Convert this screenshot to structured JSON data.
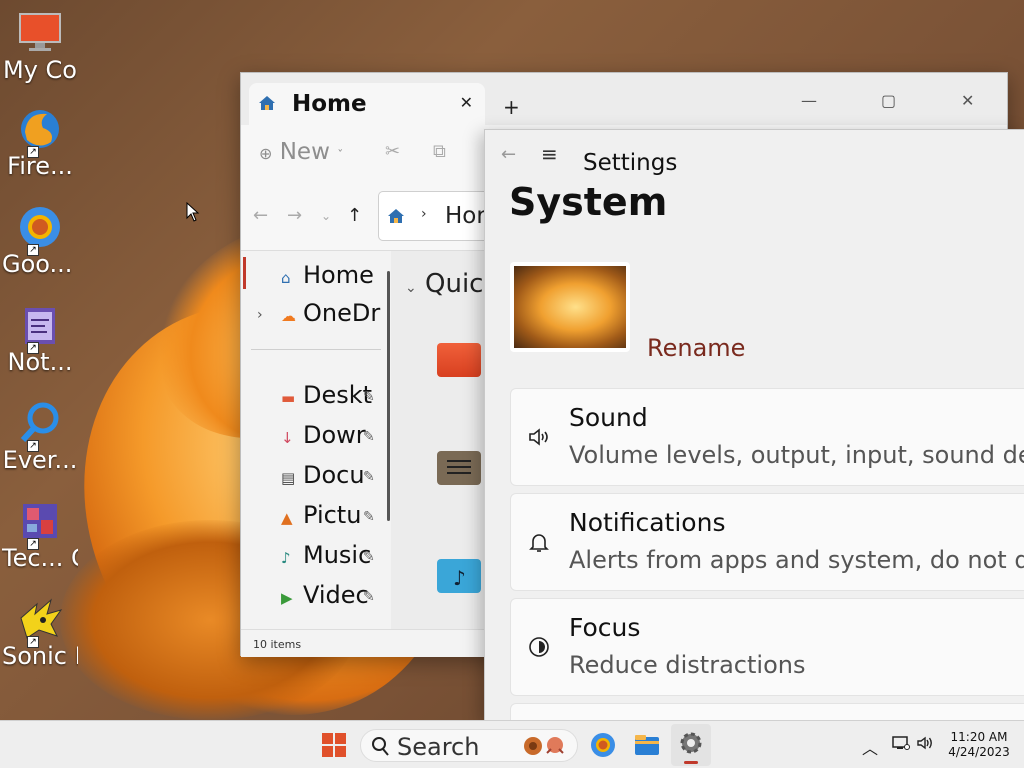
{
  "desktop": {
    "icons": [
      {
        "label": "My Co",
        "icon": "monitor-icon"
      },
      {
        "label": "Fire...",
        "icon": "firefox-icon"
      },
      {
        "label": "Goo... Chr",
        "icon": "chrome-icon"
      },
      {
        "label": "Not...",
        "icon": "notepad-icon"
      },
      {
        "label": "Ever...",
        "icon": "everything-search-icon"
      },
      {
        "label": "Tec... C",
        "icon": "app-icon"
      },
      {
        "label": "Sonic Rob...",
        "icon": "sonic-icon"
      }
    ]
  },
  "explorer": {
    "tab_title": "Home",
    "new_label": "New",
    "address_text": "Hor",
    "sidebar": [
      {
        "label": "Home",
        "icon": "home-icon"
      },
      {
        "label": "OneDr",
        "icon": "onedrive-icon"
      },
      {
        "label": "Deskt",
        "icon": "desktop-folder-icon"
      },
      {
        "label": "Dowr",
        "icon": "download-icon"
      },
      {
        "label": "Docu",
        "icon": "document-icon"
      },
      {
        "label": "Pictu",
        "icon": "pictures-icon"
      },
      {
        "label": "Music",
        "icon": "music-icon"
      },
      {
        "label": "Videc",
        "icon": "video-icon"
      }
    ],
    "quick_access_label": "Quick",
    "status_text": "10 items"
  },
  "settings": {
    "window_title": "Settings",
    "page_title": "System",
    "rename_label": "Rename",
    "cards": [
      {
        "title": "Sound",
        "subtitle": "Volume levels, output, input, sound dev",
        "icon": "speaker-icon"
      },
      {
        "title": "Notifications",
        "subtitle": "Alerts from apps and system, do not di",
        "icon": "bell-icon"
      },
      {
        "title": "Focus",
        "subtitle": "Reduce distractions",
        "icon": "focus-icon"
      }
    ]
  },
  "taskbar": {
    "search_label": "Search",
    "time": "11:20 AM",
    "date": "4/24/2023"
  },
  "colors": {
    "accent": "#c0392b",
    "rename": "#7a2a1e"
  }
}
